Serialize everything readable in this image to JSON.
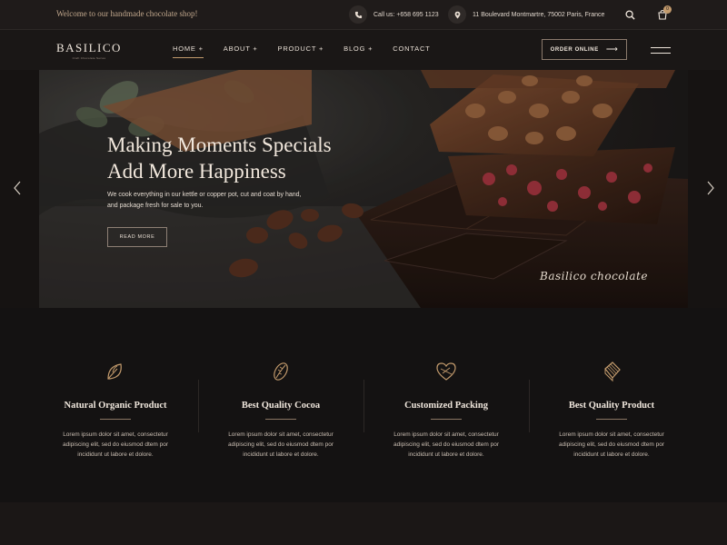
{
  "topbar": {
    "welcome": "Welcome to our handmade chocolate shop!",
    "phone": "Call us: +658 695 1123",
    "address": "11 Boulevard Montmartre, 75002 Paris, France",
    "cart_count": "0",
    "icons": [
      "phone-icon",
      "location-pin-icon",
      "search-icon",
      "cart-icon"
    ]
  },
  "header": {
    "logo": "BASILICO",
    "logo_tagline": "Craft Chocolate Series",
    "nav": [
      {
        "label": "HOME +"
      },
      {
        "label": "ABOUT +"
      },
      {
        "label": "PRODUCT +"
      },
      {
        "label": "BLOG +"
      },
      {
        "label": "CONTACT"
      }
    ],
    "order_button": "ORDER ONLINE"
  },
  "hero": {
    "title_line1": "Making Moments Specials",
    "title_line2": "Add More Happiness",
    "subtitle_line1": "We cook everything in our kettle or copper pot, cut and coat by hand,",
    "subtitle_line2": "and package fresh for sale to you.",
    "button": "READ MORE",
    "signature": "Basilico chocolate"
  },
  "features": [
    {
      "title": "Natural Organic Product",
      "icon": "leaf-icon",
      "text_line1": "Lorem ipsum dolor sit amet, consectetur",
      "text_line2": "adipiscing elit, sed do eiusmod dtem por",
      "text_line3": "incididunt ut labore et dolore."
    },
    {
      "title": "Best Quality Cocoa",
      "icon": "cocoa-bean-icon",
      "text_line1": "Lorem ipsum dolor sit amet, consectetur",
      "text_line2": "adipiscing elit, sed do eiusmod dtem por",
      "text_line3": "incididunt ut labore et dolore."
    },
    {
      "title": "Customized Packing",
      "icon": "heart-box-icon",
      "text_line1": "Lorem ipsum dolor sit amet, consectetur",
      "text_line2": "adipiscing elit, sed do eiusmod dtem por",
      "text_line3": "incididunt ut labore et dolore."
    },
    {
      "title": "Best Quality Product",
      "icon": "chocolate-bar-icon",
      "text_line1": "Lorem ipsum dolor sit amet, consectetur",
      "text_line2": "adipiscing elit, sed do eiusmod dtem por",
      "text_line3": "incididunt ut labore et dolore."
    }
  ],
  "colors": {
    "background": "#141212",
    "accent": "#c29a6c",
    "text": "#efe6dc"
  }
}
